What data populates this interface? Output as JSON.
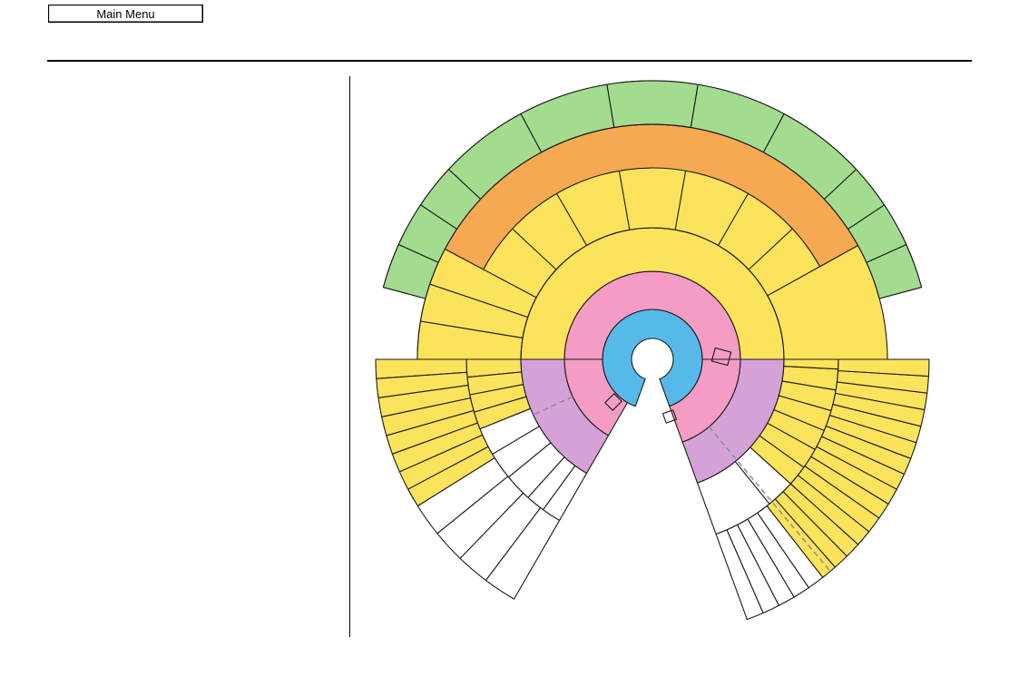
{
  "header": {
    "main_menu_label": "Main Menu"
  },
  "diagram": {
    "colors": {
      "hub": "#56b9ea",
      "pink": "#f59cc4",
      "purple": "#d5a2d8",
      "yellow": "#fde35c",
      "orange": "#f6a950",
      "green": "#a3dc8f",
      "white": "#ffffff",
      "outline": "#1a1a1a",
      "dashed": "#8c8c8c"
    }
  }
}
